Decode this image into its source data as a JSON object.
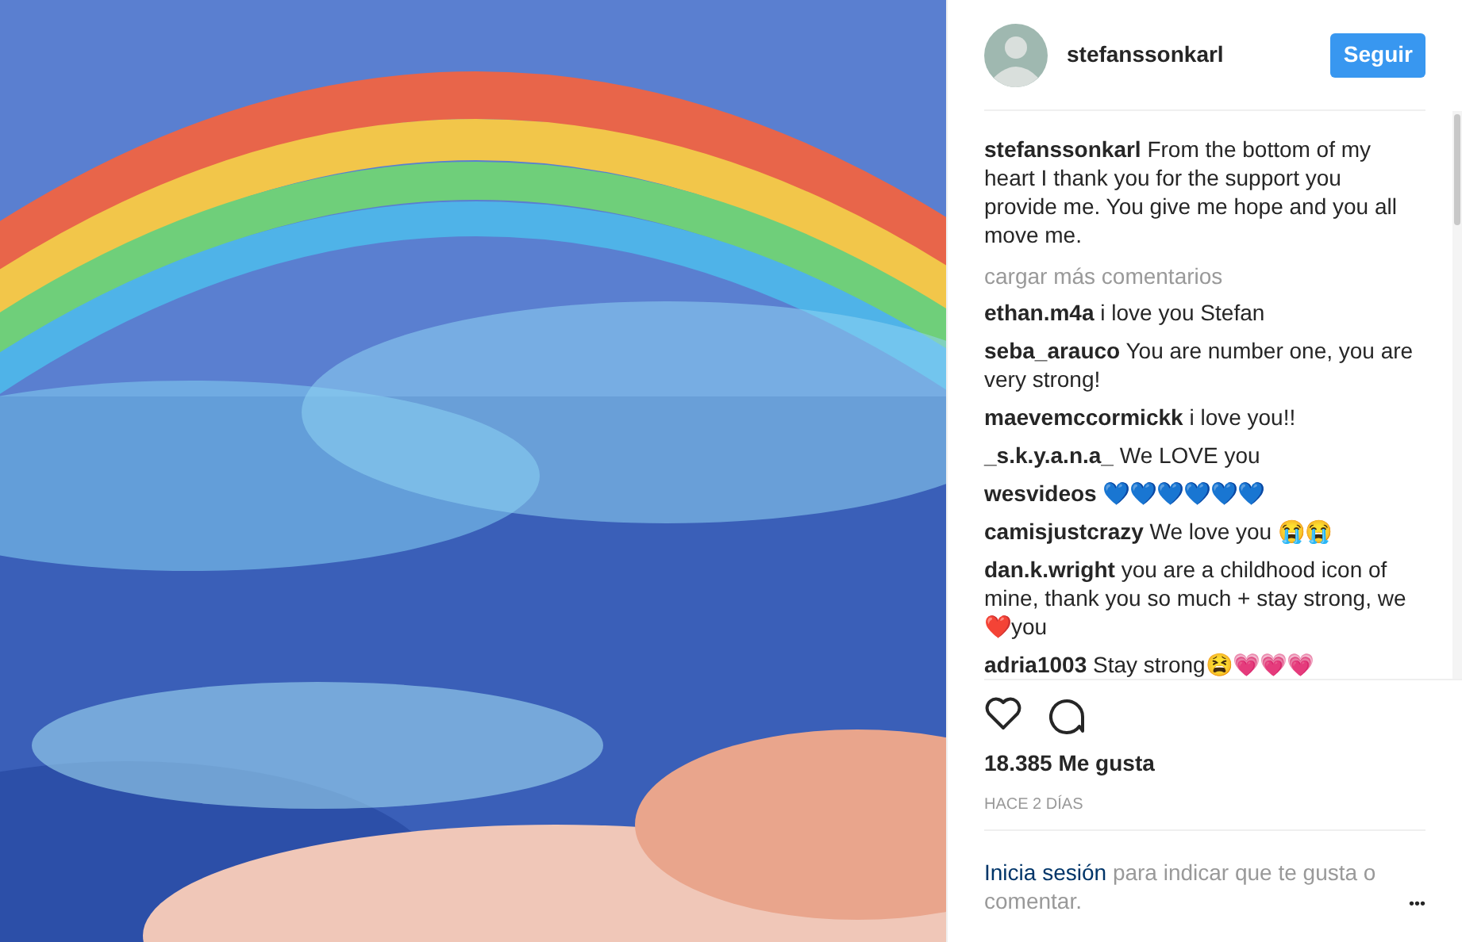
{
  "header": {
    "username": "stefanssonkarl",
    "follow_button": "Seguir"
  },
  "caption": {
    "username": "stefanssonkarl",
    "text": "From the bottom of my heart I thank you for the support you provide me. You give me hope and you all move me."
  },
  "load_more": "cargar más comentarios",
  "comments": [
    {
      "username": "ethan.m4a",
      "text": "i love you Stefan"
    },
    {
      "username": "seba_arauco",
      "text": "You are number one, you are very strong!"
    },
    {
      "username": "maevemccormickk",
      "text": "i love you!!"
    },
    {
      "username": "_s.k.y.a.n.a_",
      "text": "We LOVE you"
    },
    {
      "username": "wesvideos",
      "text": "💙💙💙💙💙💙"
    },
    {
      "username": "camisjustcrazy",
      "text": "We love you 😭😭"
    },
    {
      "username": "dan.k.wright",
      "text": "you are a childhood icon of mine, thank you so much + stay strong, we ❤️you"
    },
    {
      "username": "adria1003",
      "text": "Stay strong😫💗💗💗"
    }
  ],
  "likes": "18.385 Me gusta",
  "time": "HACE 2 DÍAS",
  "login": {
    "link": "Inicia sesión",
    "text": "para indicar que te gusta o comentar."
  },
  "more_button": "•••"
}
